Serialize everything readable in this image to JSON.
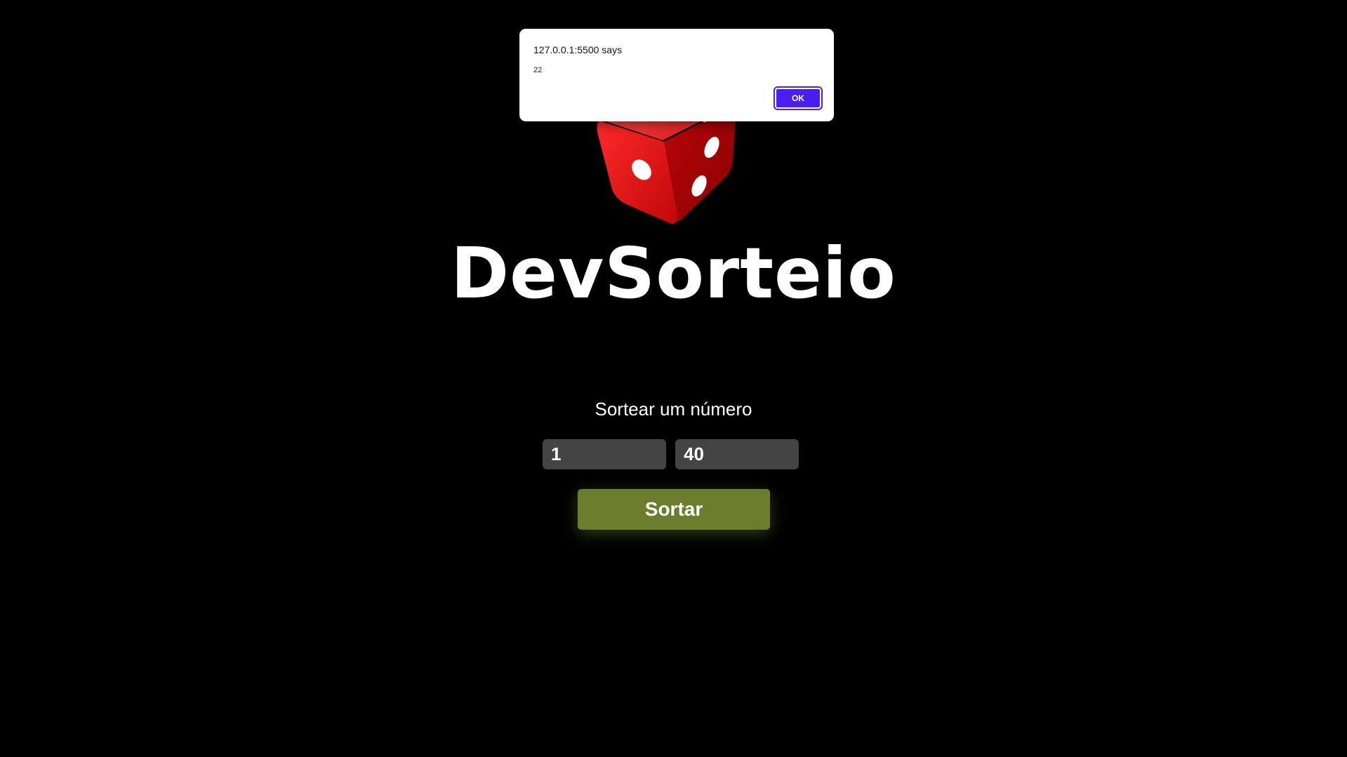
{
  "app": {
    "title": "DevSorteio",
    "subtitle": "Sortear um número"
  },
  "form": {
    "min_value": "1",
    "max_value": "40",
    "submit_label": "Sortar",
    "submit_color": "#6b7c2c"
  },
  "dialog": {
    "origin": "127.0.0.1:5500 says",
    "message": "22",
    "ok_label": "OK",
    "ok_color": "#4a1df0"
  },
  "icons": {
    "logo": "red-dice-icon"
  },
  "colors": {
    "background": "#000000",
    "input_bg": "#444444",
    "dice_red": "#e01010"
  }
}
